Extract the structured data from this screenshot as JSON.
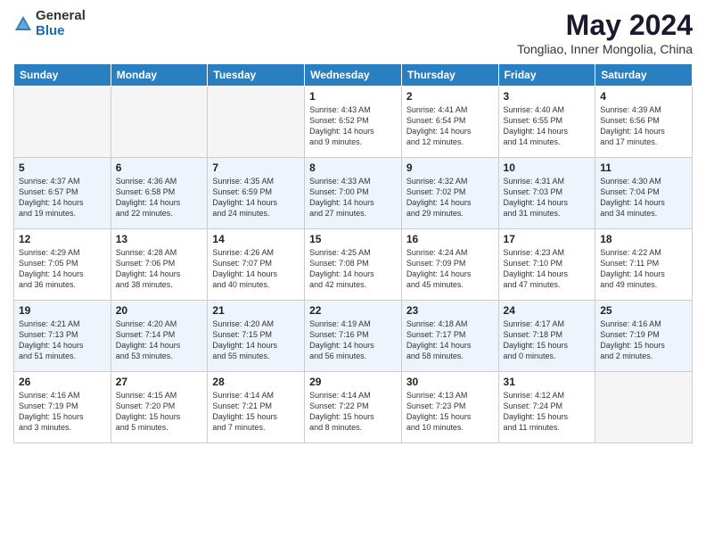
{
  "header": {
    "logo_general": "General",
    "logo_blue": "Blue",
    "title": "May 2024",
    "subtitle": "Tongliao, Inner Mongolia, China"
  },
  "days_of_week": [
    "Sunday",
    "Monday",
    "Tuesday",
    "Wednesday",
    "Thursday",
    "Friday",
    "Saturday"
  ],
  "weeks": [
    {
      "alt": false,
      "days": [
        {
          "num": "",
          "info": ""
        },
        {
          "num": "",
          "info": ""
        },
        {
          "num": "",
          "info": ""
        },
        {
          "num": "1",
          "info": "Sunrise: 4:43 AM\nSunset: 6:52 PM\nDaylight: 14 hours\nand 9 minutes."
        },
        {
          "num": "2",
          "info": "Sunrise: 4:41 AM\nSunset: 6:54 PM\nDaylight: 14 hours\nand 12 minutes."
        },
        {
          "num": "3",
          "info": "Sunrise: 4:40 AM\nSunset: 6:55 PM\nDaylight: 14 hours\nand 14 minutes."
        },
        {
          "num": "4",
          "info": "Sunrise: 4:39 AM\nSunset: 6:56 PM\nDaylight: 14 hours\nand 17 minutes."
        }
      ]
    },
    {
      "alt": true,
      "days": [
        {
          "num": "5",
          "info": "Sunrise: 4:37 AM\nSunset: 6:57 PM\nDaylight: 14 hours\nand 19 minutes."
        },
        {
          "num": "6",
          "info": "Sunrise: 4:36 AM\nSunset: 6:58 PM\nDaylight: 14 hours\nand 22 minutes."
        },
        {
          "num": "7",
          "info": "Sunrise: 4:35 AM\nSunset: 6:59 PM\nDaylight: 14 hours\nand 24 minutes."
        },
        {
          "num": "8",
          "info": "Sunrise: 4:33 AM\nSunset: 7:00 PM\nDaylight: 14 hours\nand 27 minutes."
        },
        {
          "num": "9",
          "info": "Sunrise: 4:32 AM\nSunset: 7:02 PM\nDaylight: 14 hours\nand 29 minutes."
        },
        {
          "num": "10",
          "info": "Sunrise: 4:31 AM\nSunset: 7:03 PM\nDaylight: 14 hours\nand 31 minutes."
        },
        {
          "num": "11",
          "info": "Sunrise: 4:30 AM\nSunset: 7:04 PM\nDaylight: 14 hours\nand 34 minutes."
        }
      ]
    },
    {
      "alt": false,
      "days": [
        {
          "num": "12",
          "info": "Sunrise: 4:29 AM\nSunset: 7:05 PM\nDaylight: 14 hours\nand 36 minutes."
        },
        {
          "num": "13",
          "info": "Sunrise: 4:28 AM\nSunset: 7:06 PM\nDaylight: 14 hours\nand 38 minutes."
        },
        {
          "num": "14",
          "info": "Sunrise: 4:26 AM\nSunset: 7:07 PM\nDaylight: 14 hours\nand 40 minutes."
        },
        {
          "num": "15",
          "info": "Sunrise: 4:25 AM\nSunset: 7:08 PM\nDaylight: 14 hours\nand 42 minutes."
        },
        {
          "num": "16",
          "info": "Sunrise: 4:24 AM\nSunset: 7:09 PM\nDaylight: 14 hours\nand 45 minutes."
        },
        {
          "num": "17",
          "info": "Sunrise: 4:23 AM\nSunset: 7:10 PM\nDaylight: 14 hours\nand 47 minutes."
        },
        {
          "num": "18",
          "info": "Sunrise: 4:22 AM\nSunset: 7:11 PM\nDaylight: 14 hours\nand 49 minutes."
        }
      ]
    },
    {
      "alt": true,
      "days": [
        {
          "num": "19",
          "info": "Sunrise: 4:21 AM\nSunset: 7:13 PM\nDaylight: 14 hours\nand 51 minutes."
        },
        {
          "num": "20",
          "info": "Sunrise: 4:20 AM\nSunset: 7:14 PM\nDaylight: 14 hours\nand 53 minutes."
        },
        {
          "num": "21",
          "info": "Sunrise: 4:20 AM\nSunset: 7:15 PM\nDaylight: 14 hours\nand 55 minutes."
        },
        {
          "num": "22",
          "info": "Sunrise: 4:19 AM\nSunset: 7:16 PM\nDaylight: 14 hours\nand 56 minutes."
        },
        {
          "num": "23",
          "info": "Sunrise: 4:18 AM\nSunset: 7:17 PM\nDaylight: 14 hours\nand 58 minutes."
        },
        {
          "num": "24",
          "info": "Sunrise: 4:17 AM\nSunset: 7:18 PM\nDaylight: 15 hours\nand 0 minutes."
        },
        {
          "num": "25",
          "info": "Sunrise: 4:16 AM\nSunset: 7:19 PM\nDaylight: 15 hours\nand 2 minutes."
        }
      ]
    },
    {
      "alt": false,
      "days": [
        {
          "num": "26",
          "info": "Sunrise: 4:16 AM\nSunset: 7:19 PM\nDaylight: 15 hours\nand 3 minutes."
        },
        {
          "num": "27",
          "info": "Sunrise: 4:15 AM\nSunset: 7:20 PM\nDaylight: 15 hours\nand 5 minutes."
        },
        {
          "num": "28",
          "info": "Sunrise: 4:14 AM\nSunset: 7:21 PM\nDaylight: 15 hours\nand 7 minutes."
        },
        {
          "num": "29",
          "info": "Sunrise: 4:14 AM\nSunset: 7:22 PM\nDaylight: 15 hours\nand 8 minutes."
        },
        {
          "num": "30",
          "info": "Sunrise: 4:13 AM\nSunset: 7:23 PM\nDaylight: 15 hours\nand 10 minutes."
        },
        {
          "num": "31",
          "info": "Sunrise: 4:12 AM\nSunset: 7:24 PM\nDaylight: 15 hours\nand 11 minutes."
        },
        {
          "num": "",
          "info": ""
        }
      ]
    }
  ]
}
